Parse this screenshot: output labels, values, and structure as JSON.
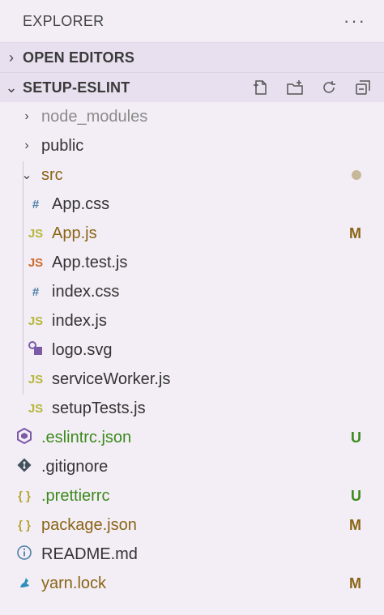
{
  "explorer": {
    "title": "EXPLORER",
    "more": "···"
  },
  "open_editors": {
    "label": "OPEN EDITORS"
  },
  "folder": {
    "label": "SETUP-ESLINT"
  },
  "tree": [
    {
      "name": "node_modules",
      "kind": "folder",
      "state": "collapsed",
      "status": ""
    },
    {
      "name": "public",
      "kind": "folder",
      "state": "collapsed",
      "status": ""
    },
    {
      "name": "src",
      "kind": "folder",
      "state": "expanded",
      "status": "dot"
    },
    {
      "name": "App.css",
      "icon": "#",
      "status": ""
    },
    {
      "name": "App.js",
      "icon": "JS",
      "status": "M"
    },
    {
      "name": "App.test.js",
      "icon": "JS",
      "status": ""
    },
    {
      "name": "index.css",
      "icon": "#",
      "status": ""
    },
    {
      "name": "index.js",
      "icon": "JS",
      "status": ""
    },
    {
      "name": "logo.svg",
      "icon": "svg",
      "status": ""
    },
    {
      "name": "serviceWorker.js",
      "icon": "JS",
      "status": ""
    },
    {
      "name": "setupTests.js",
      "icon": "JS",
      "status": ""
    },
    {
      "name": ".eslintrc.json",
      "icon": "eslint",
      "status": "U"
    },
    {
      "name": ".gitignore",
      "icon": "git",
      "status": ""
    },
    {
      "name": ".prettierrc",
      "icon": "{ }",
      "status": "U"
    },
    {
      "name": "package.json",
      "icon": "{ }",
      "status": "M"
    },
    {
      "name": "README.md",
      "icon": "info",
      "status": ""
    },
    {
      "name": "yarn.lock",
      "icon": "yarn",
      "status": "M"
    }
  ],
  "colors": {
    "background": "#f3eef6",
    "section_header": "#e8e0ef",
    "modified": "#8a6414",
    "untracked": "#3c8a1b",
    "ignored": "#8a8a8a"
  }
}
